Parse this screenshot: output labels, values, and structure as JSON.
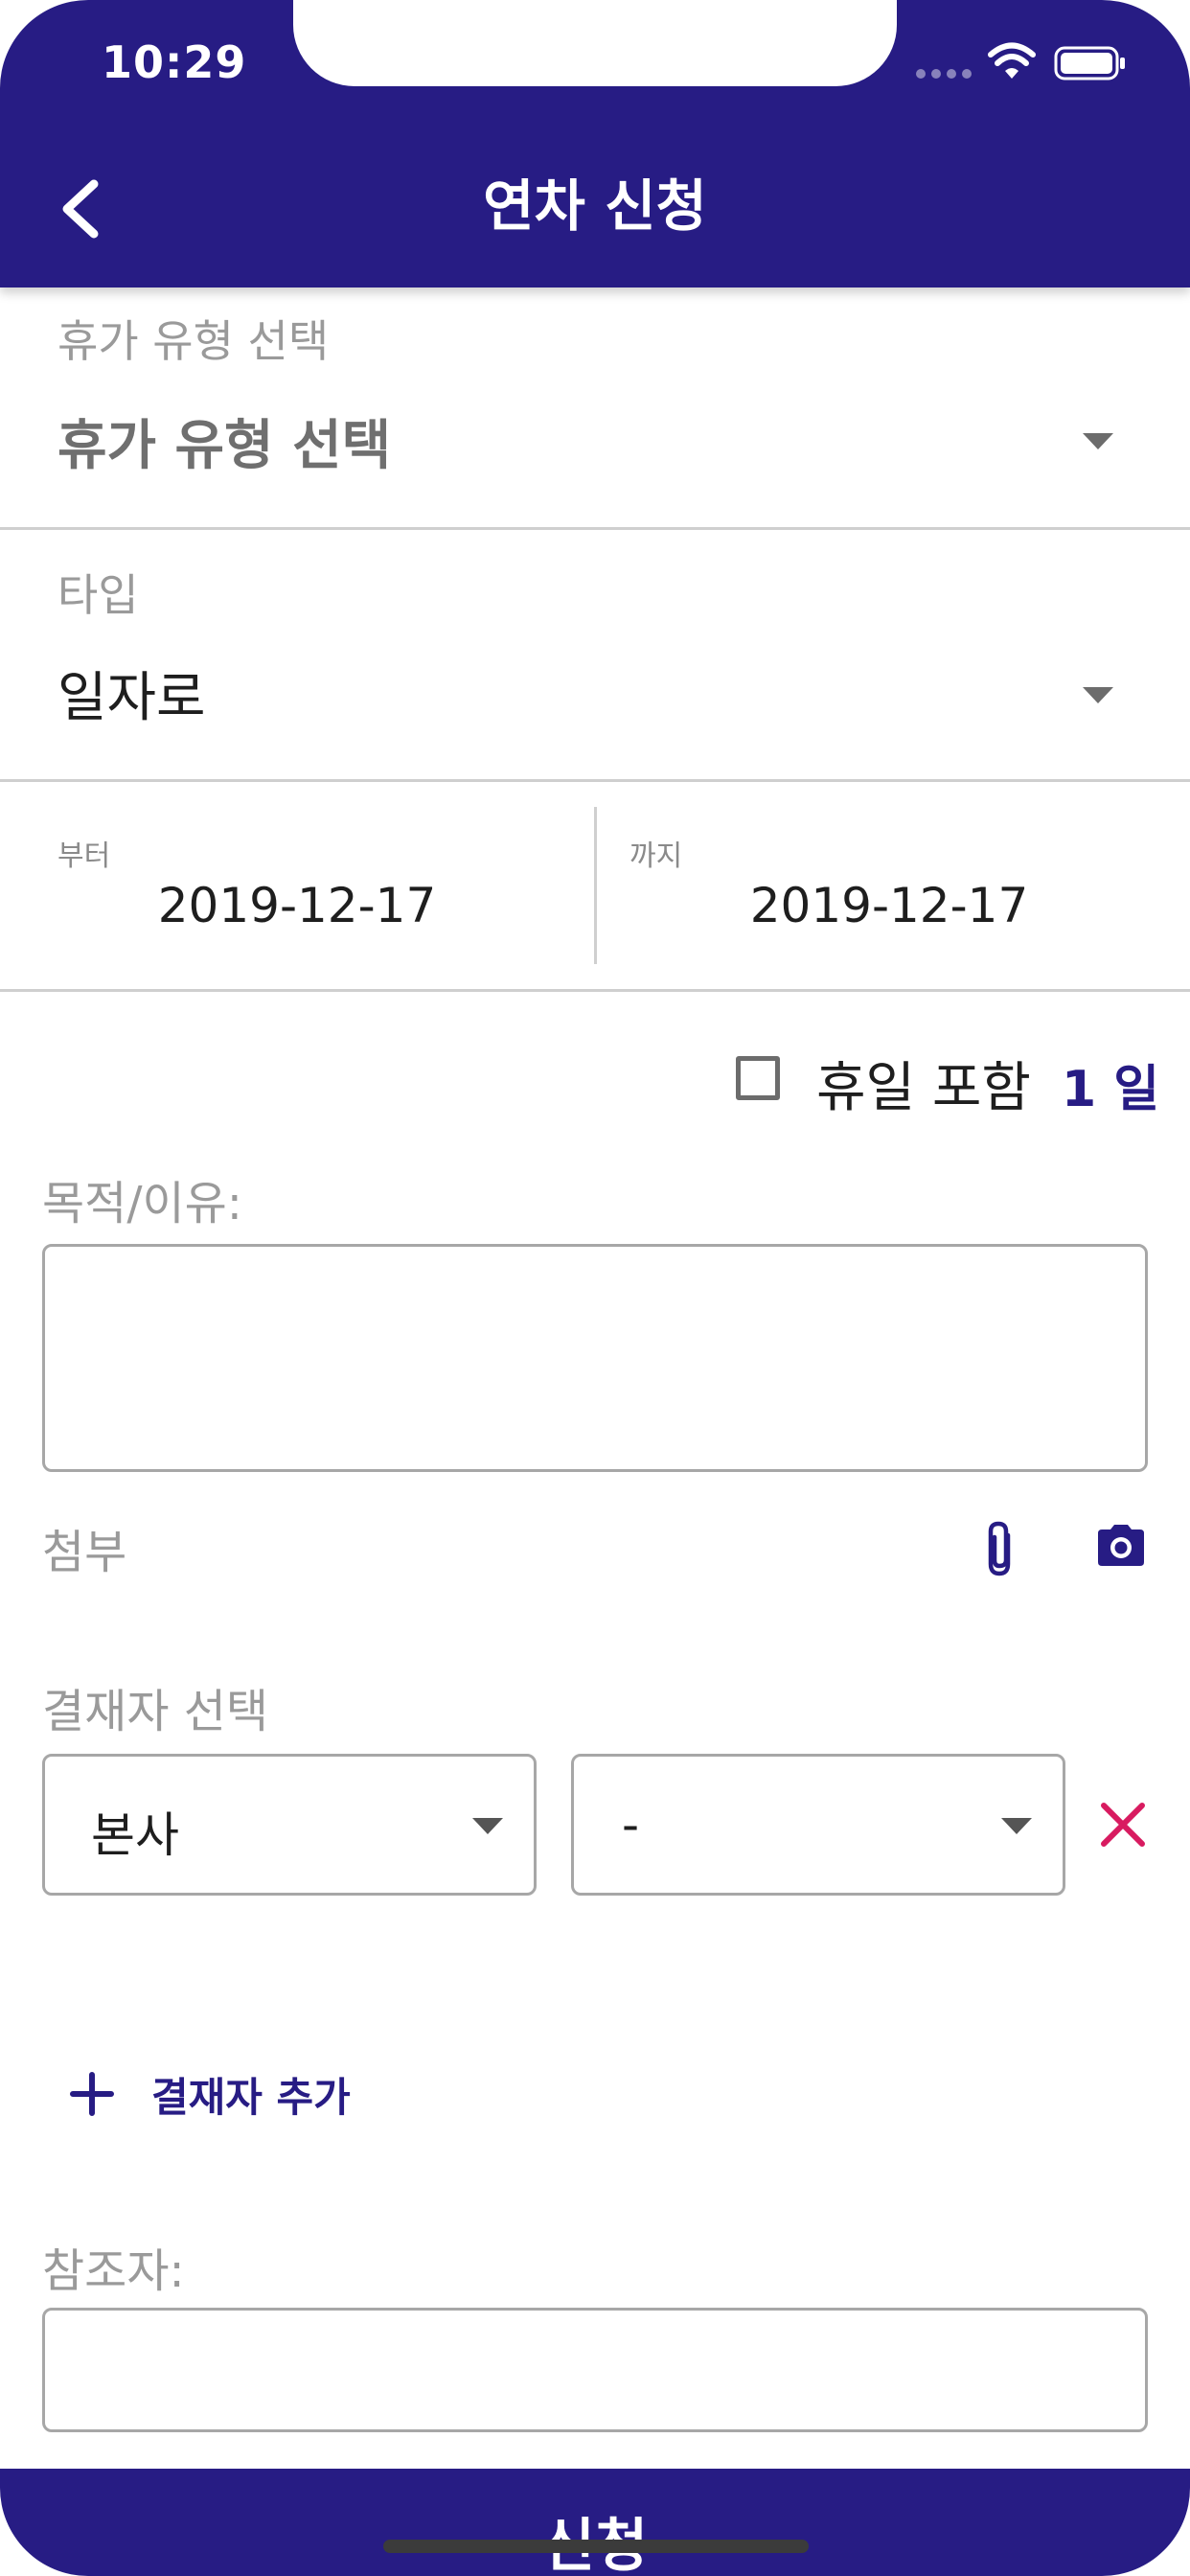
{
  "status_bar": {
    "time": "10:29"
  },
  "header": {
    "title": "연차 신청",
    "back_icon": "chevron-left-icon"
  },
  "leave_type": {
    "label": "휴가 유형 선택",
    "value": "휴가 유형 선택"
  },
  "type": {
    "label": "타입",
    "value": "일자로"
  },
  "date_range": {
    "from_label": "부터",
    "from_value": "2019-12-17",
    "to_label": "까지",
    "to_value": "2019-12-17"
  },
  "holiday": {
    "label": "휴일 포함",
    "checked": false,
    "days": "1 일"
  },
  "purpose": {
    "label": "목적/이유:",
    "value": ""
  },
  "attachment": {
    "label": "첨부",
    "icons": [
      "paperclip-icon",
      "camera-icon"
    ]
  },
  "approver": {
    "label": "결재자 선택",
    "department": "본사",
    "person": "-",
    "add_label": "결재자 추가",
    "remove_icon": "close-icon"
  },
  "reference": {
    "label": "참조자:",
    "value": ""
  },
  "submit": {
    "label": "신청"
  },
  "colors": {
    "primary": "#271c84",
    "danger": "#d81b60",
    "border": "#a7a7a7",
    "label": "#9a9a9a"
  }
}
